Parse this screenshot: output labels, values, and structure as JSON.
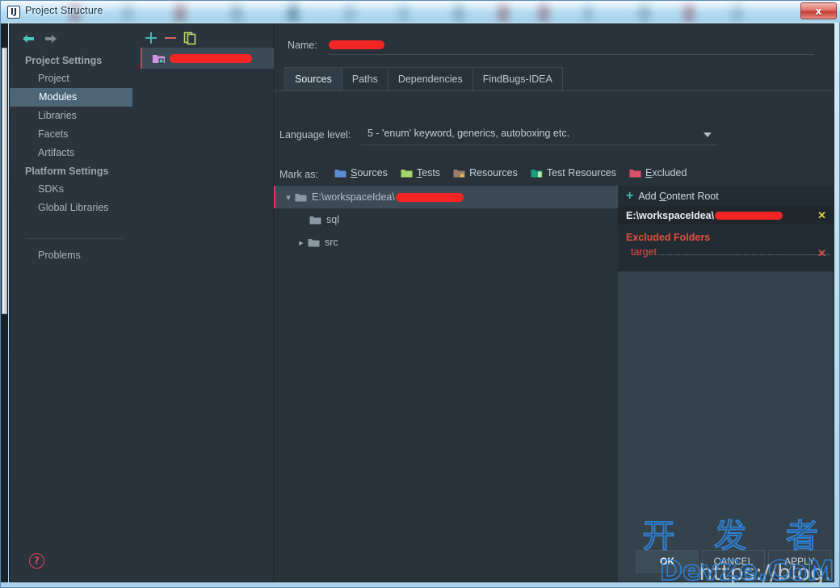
{
  "window": {
    "title": "Project Structure",
    "app_icon": "intellij-idea-icon",
    "close_label": "x"
  },
  "sidebar": {
    "nav": {
      "back": "back-arrow-icon",
      "forward": "forward-arrow-icon"
    },
    "groups": [
      {
        "title": "Project Settings",
        "items": [
          {
            "label": "Project",
            "selected": false
          },
          {
            "label": "Modules",
            "selected": true
          },
          {
            "label": "Libraries",
            "selected": false
          },
          {
            "label": "Facets",
            "selected": false
          },
          {
            "label": "Artifacts",
            "selected": false
          }
        ]
      },
      {
        "title": "Platform Settings",
        "items": [
          {
            "label": "SDKs",
            "selected": false
          },
          {
            "label": "Global Libraries",
            "selected": false
          }
        ]
      }
    ],
    "problems_label": "Problems",
    "help_label": "?"
  },
  "modules_pane": {
    "toolbar": {
      "add": "plus-icon",
      "remove": "minus-icon",
      "copy": "copy-icon"
    },
    "items": [
      {
        "icon": "module-folder-icon",
        "label": "",
        "redacted": true,
        "selected": true
      }
    ]
  },
  "detail": {
    "name_label": "Name:",
    "name_value": "",
    "name_redacted": true,
    "tabs": [
      {
        "label": "Sources",
        "active": true
      },
      {
        "label": "Paths",
        "active": false
      },
      {
        "label": "Dependencies",
        "active": false
      },
      {
        "label": "FindBugs-IDEA",
        "active": false
      }
    ],
    "language_level_label": "Language level:",
    "language_level_value": "5 - 'enum' keyword, generics, autoboxing etc.",
    "mark_as_label": "Mark as:",
    "mark_as_options": [
      {
        "label": "Sources",
        "accel": "S",
        "color": "#5b8dd9",
        "icon": "blue-folder-icon"
      },
      {
        "label": "Tests",
        "accel": "T",
        "color": "#a5d66a",
        "icon": "green-folder-icon"
      },
      {
        "label": "Resources",
        "accel": "",
        "color": "#9b7d6b",
        "icon": "brown-folder-icon"
      },
      {
        "label": "Test Resources",
        "accel": "",
        "color": "#17a07e",
        "icon": "teal-folder-icon"
      },
      {
        "label": "Excluded",
        "accel": "E",
        "color": "#dd4f6b",
        "icon": "red-folder-icon"
      }
    ],
    "tree": [
      {
        "indent": 0,
        "caret": "expanded",
        "icon": "folder-icon",
        "label": "E:\\workspaceIdea\\",
        "redacted": true,
        "selected": true
      },
      {
        "indent": 1,
        "caret": "none",
        "icon": "folder-icon",
        "label": "sql",
        "redacted": false,
        "selected": false
      },
      {
        "indent": 1,
        "caret": "collapsed",
        "icon": "folder-icon",
        "label": "src",
        "redacted": false,
        "selected": false
      }
    ]
  },
  "roots_panel": {
    "add_content_root_label": "Add Content Root",
    "add_icon": "plus-icon",
    "content_root_path": "E:\\workspaceIdea\\",
    "content_root_redacted": true,
    "content_root_remove_icon": "close-x-icon",
    "excluded_title": "Excluded Folders",
    "excluded_folders": [
      {
        "name": "target",
        "remove_icon": "close-x-icon"
      }
    ]
  },
  "footer": {
    "ok_label": "OK",
    "cancel_label": "CANCEL",
    "apply_label": "APPLY"
  },
  "watermark": {
    "chinese": "开 发 者",
    "url_prefix": "https://blog.",
    "url_brand": "DevZe.CoM"
  },
  "colors": {
    "accent_pink": "#e03a5c",
    "accent_teal": "#3fb9b2",
    "excluded_red": "#e0503f",
    "selection_blue": "#4c6678",
    "panel_bg": "#293239",
    "roots_bg": "#33424b"
  }
}
